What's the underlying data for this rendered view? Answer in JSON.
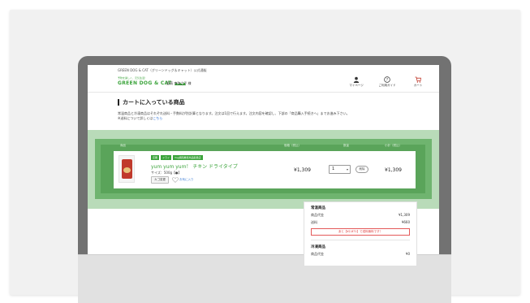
{
  "header": {
    "top_line": "GREEN DOG & CAT（グリーンドッグ＆キャット）公式通販",
    "logo_tagline": "予防を楽しく、元気生活！",
    "logo_text": "GREEN DOG & CAT",
    "user_name": "亜萌 幸弥之子 様",
    "nav": [
      {
        "label": "マイページ",
        "icon": "user-icon"
      },
      {
        "label": "ご利用ガイド",
        "icon": "help-icon"
      },
      {
        "label": "カート",
        "icon": "cart-icon"
      }
    ]
  },
  "page": {
    "title": "カートに入っている商品",
    "notice_line1": "常温商品と冷凍商品はそれぞれ送料・手数料が別計算となります。注文は1回で行えます。注文内容を確認し、下部の「商品購入手続きへ」までお進み下さい。",
    "notice_line2_prefix": "※送料について詳しくは",
    "notice_link": "こちら"
  },
  "cart": {
    "columns": [
      "商品",
      "価格（税込）",
      "数量",
      "小計（税込）"
    ],
    "items": [
      {
        "tags": [
          "定期",
          "ドライ",
          "Vsg病院推奨商品取扱店"
        ],
        "name": "yum yum yum！ チキン ドライタイプ",
        "size": "サイズ：500g【●】",
        "cart_button": "カゴ変更",
        "favorite_label": "お気に入り",
        "price": "¥1,309",
        "quantity": "1",
        "delete_label": "削除",
        "subtotal": "¥1,309"
      }
    ]
  },
  "summary": {
    "section1_title": "常温商品",
    "rows": [
      {
        "label": "商品代金",
        "value": "¥1,309"
      },
      {
        "label": "送料",
        "value": "¥660"
      }
    ],
    "alert": "あと【¥2,671】で送料無料です！",
    "section2_title": "冷凍商品",
    "row2": {
      "label": "商品代金",
      "value": "¥0"
    }
  },
  "colors": {
    "brand_green": "#3aa33a",
    "highlight": "#5aa45a",
    "alert_red": "#d33333"
  }
}
